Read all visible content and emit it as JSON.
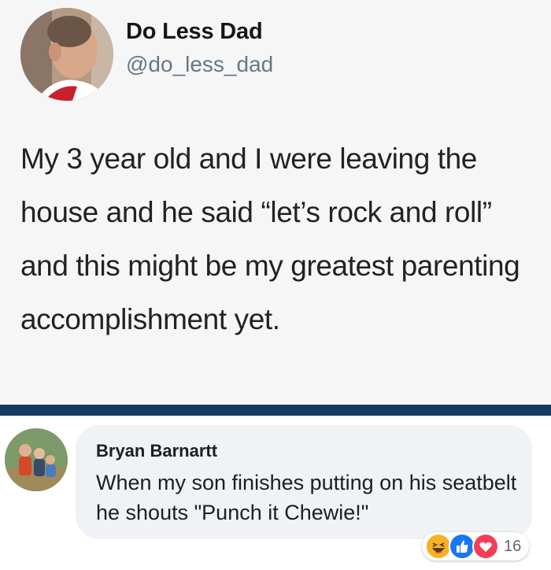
{
  "tweet": {
    "display_name": "Do Less Dad",
    "handle": "@do_less_dad",
    "text": "My 3 year old and I were leaving the house and he said “let’s rock and roll” and this might be my greatest parenting accomplishment yet."
  },
  "comment": {
    "author": "Bryan Barnartt",
    "text": "When my son finishes putting on his seatbelt he shouts \"Punch it Chewie!\"",
    "reactions": {
      "icons": [
        "haha-icon",
        "like-icon",
        "love-icon"
      ],
      "count": "16"
    }
  },
  "colors": {
    "divider": "#163a61",
    "tweet_background": "#f6f6f6",
    "bubble_background": "#f0f2f5",
    "like": "#1877f2",
    "love": "#f33e58",
    "haha": "#f7b125"
  }
}
